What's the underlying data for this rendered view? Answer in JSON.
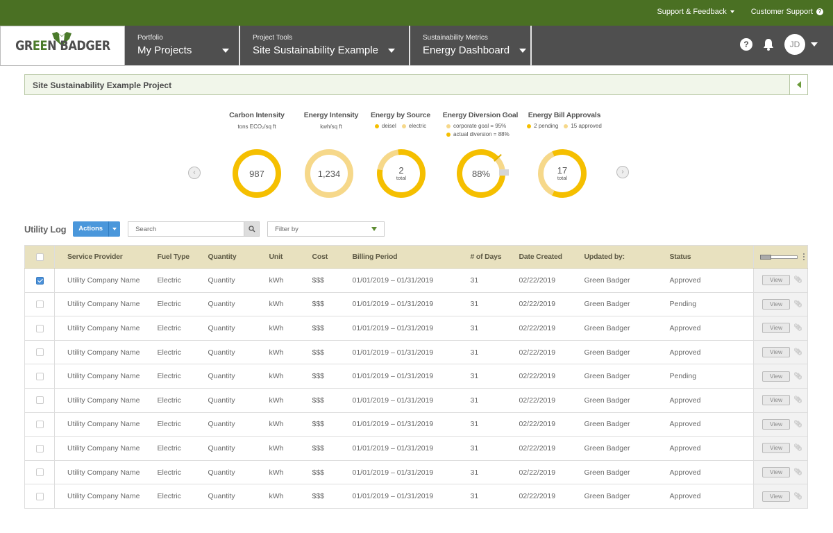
{
  "topbar": {
    "support_feedback": "Support & Feedback",
    "customer_support": "Customer Support"
  },
  "brand": {
    "logo_left": "GR",
    "logo_mid": "EE",
    "logo_right": "N BADGER",
    "color": "#4a7023"
  },
  "nav": {
    "sections": [
      {
        "label": "Portfolio",
        "value": "My Projects"
      },
      {
        "label": "Project Tools",
        "value": "Site Sustainability Example"
      },
      {
        "label": "Sustainability Metrics",
        "value": "Energy Dashboard"
      }
    ],
    "user_initials": "JD",
    "help_glyph": "?"
  },
  "project": {
    "title": "Site Sustainability Example Project"
  },
  "colors": {
    "primary_yellow": "#f5bf00",
    "light_yellow": "#f6d88a",
    "grey": "#d6d6d6",
    "action_blue": "#4a97db"
  },
  "metrics": [
    {
      "title": "Carbon Intensity",
      "subtitle": "tons ECO₂/sq ft",
      "value": "987",
      "unit": ""
    },
    {
      "title": "Energy Intensity",
      "subtitle": "kwh/sq ft",
      "value": "1,234",
      "unit": ""
    },
    {
      "title": "Energy by Source",
      "legend": [
        "deisel",
        "electric"
      ],
      "value": "2",
      "unit": "total",
      "dark_fraction": 0.8
    },
    {
      "title": "Energy Diversion Goal",
      "legend": [
        "corporate goal = 95%",
        "actual diversion = 88%"
      ],
      "value": "88%",
      "goal_percent": 95,
      "actual_percent": 88
    },
    {
      "title": "Energy Bill Approvals",
      "legend": [
        "2 pending",
        "15 approved"
      ],
      "value": "17",
      "unit": "total",
      "pending": 2,
      "approved": 15
    }
  ],
  "utility_log": {
    "title": "Utility Log",
    "actions_label": "Actions",
    "search_placeholder": "Search",
    "filter_label": "Filter by",
    "columns": [
      "Service Provider",
      "Fuel Type",
      "Quantity",
      "Unit",
      "Cost",
      "Billing Period",
      "# of Days",
      "Date Created",
      "Updated by:",
      "Status"
    ],
    "view_label": "View",
    "rows": [
      {
        "checked": true,
        "provider": "Utility Company Name",
        "fuel": "Electric",
        "quantity": "Quantity",
        "unit": "kWh",
        "cost": "$$$",
        "period": "01/01/2019 – 01/31/2019",
        "days": "31",
        "created": "02/22/2019",
        "updated_by": "Green Badger",
        "status": "Approved"
      },
      {
        "checked": false,
        "provider": "Utility Company Name",
        "fuel": "Electric",
        "quantity": "Quantity",
        "unit": "kWh",
        "cost": "$$$",
        "period": "01/01/2019 – 01/31/2019",
        "days": "31",
        "created": "02/22/2019",
        "updated_by": "Green Badger",
        "status": "Pending"
      },
      {
        "checked": false,
        "provider": "Utility Company Name",
        "fuel": "Electric",
        "quantity": "Quantity",
        "unit": "kWh",
        "cost": "$$$",
        "period": "01/01/2019 – 01/31/2019",
        "days": "31",
        "created": "02/22/2019",
        "updated_by": "Green Badger",
        "status": "Approved"
      },
      {
        "checked": false,
        "provider": "Utility Company Name",
        "fuel": "Electric",
        "quantity": "Quantity",
        "unit": "kWh",
        "cost": "$$$",
        "period": "01/01/2019 – 01/31/2019",
        "days": "31",
        "created": "02/22/2019",
        "updated_by": "Green Badger",
        "status": "Approved"
      },
      {
        "checked": false,
        "provider": "Utility Company Name",
        "fuel": "Electric",
        "quantity": "Quantity",
        "unit": "kWh",
        "cost": "$$$",
        "period": "01/01/2019 – 01/31/2019",
        "days": "31",
        "created": "02/22/2019",
        "updated_by": "Green Badger",
        "status": "Pending"
      },
      {
        "checked": false,
        "provider": "Utility Company Name",
        "fuel": "Electric",
        "quantity": "Quantity",
        "unit": "kWh",
        "cost": "$$$",
        "period": "01/01/2019 – 01/31/2019",
        "days": "31",
        "created": "02/22/2019",
        "updated_by": "Green Badger",
        "status": "Approved"
      },
      {
        "checked": false,
        "provider": "Utility Company Name",
        "fuel": "Electric",
        "quantity": "Quantity",
        "unit": "kWh",
        "cost": "$$$",
        "period": "01/01/2019 – 01/31/2019",
        "days": "31",
        "created": "02/22/2019",
        "updated_by": "Green Badger",
        "status": "Approved"
      },
      {
        "checked": false,
        "provider": "Utility Company Name",
        "fuel": "Electric",
        "quantity": "Quantity",
        "unit": "kWh",
        "cost": "$$$",
        "period": "01/01/2019 – 01/31/2019",
        "days": "31",
        "created": "02/22/2019",
        "updated_by": "Green Badger",
        "status": "Approved"
      },
      {
        "checked": false,
        "provider": "Utility Company Name",
        "fuel": "Electric",
        "quantity": "Quantity",
        "unit": "kWh",
        "cost": "$$$",
        "period": "01/01/2019 – 01/31/2019",
        "days": "31",
        "created": "02/22/2019",
        "updated_by": "Green Badger",
        "status": "Approved"
      },
      {
        "checked": false,
        "provider": "Utility Company Name",
        "fuel": "Electric",
        "quantity": "Quantity",
        "unit": "kWh",
        "cost": "$$$",
        "period": "01/01/2019 – 01/31/2019",
        "days": "31",
        "created": "02/22/2019",
        "updated_by": "Green Badger",
        "status": "Approved"
      }
    ]
  }
}
